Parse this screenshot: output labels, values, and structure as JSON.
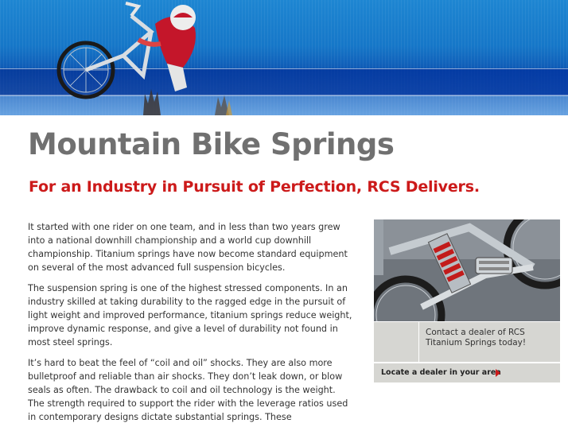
{
  "page": {
    "title": "Mountain Bike Springs",
    "subtitle": "For an Industry in Pursuit of Perfection, RCS Delivers."
  },
  "body": {
    "paragraphs": [
      "It started with one rider on one team, and in less than two years grew into a national downhill championship and a world cup downhill championship. Titanium springs have now become standard equipment on several of the most advanced full suspension bicycles.",
      "The suspension spring is one of the highest stressed components. In an industry skilled at taking durability to the ragged edge in the pursuit of light weight and improved performance, titanium springs reduce weight, improve dynamic response, and give a level of durability not found in most steel springs.",
      "It’s hard to beat the feel of “coil and oil” shocks. They are also more bulletproof and reliable than air shocks. They don’t leak down, or blow seals as often. The drawback to coil and oil technology is the weight. The strength required to support the rider with the leverage ratios used in contemporary designs dictate substantial springs. These"
    ]
  },
  "sidebar": {
    "dealer_message": "Contact a dealer of RCS Titanium Springs today!",
    "dealer_link_label": "Locate a dealer in your area"
  },
  "colors": {
    "title": "#707070",
    "subtitle": "#cc1a1a",
    "banner_blue": "#1677c8",
    "sidebar_gray": "#d6d6d2",
    "link_arrow": "#cc1a1a"
  }
}
